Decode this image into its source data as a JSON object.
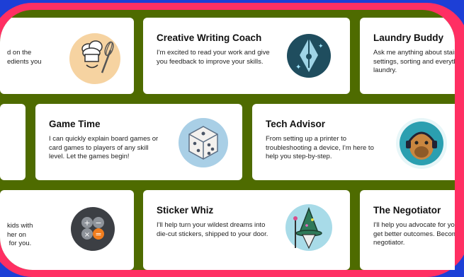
{
  "cards": [
    {
      "title": "",
      "desc": "d on the\nedients you",
      "icon": "chef-hat-whisk-icon"
    },
    {
      "title": "Creative Writing Coach",
      "desc": "I'm excited to read your work and give\nyou feedback to improve your skills.",
      "icon": "fountain-pen-icon"
    },
    {
      "title": "Laundry Buddy",
      "desc": "Ask me anything about stains,\nsettings, sorting and everything\nlaundry.",
      "icon": "laundry-icon"
    },
    {
      "title": "Game Time",
      "desc": "I can quickly explain board games or\ncard games to players of any skill\nlevel. Let the games begin!",
      "icon": "dice-icon"
    },
    {
      "title": "Tech Advisor",
      "desc": "From setting up a printer to\ntroubleshooting a device, I'm here to\nhelp you step-by-step.",
      "icon": "capybara-headset-icon"
    },
    {
      "title": "",
      "desc": "kids with\nher on\n for you.",
      "icon": "calculator-icon"
    },
    {
      "title": "Sticker Whiz",
      "desc": "I'll help turn your wildest dreams into\ndie-cut stickers, shipped to your door.",
      "icon": "wizard-sticker-icon"
    },
    {
      "title": "The Negotiator",
      "desc": "I'll help you advocate for yourself\nget better outcomes. Become a\nnegotiator.",
      "icon": "negotiator-icon"
    }
  ]
}
